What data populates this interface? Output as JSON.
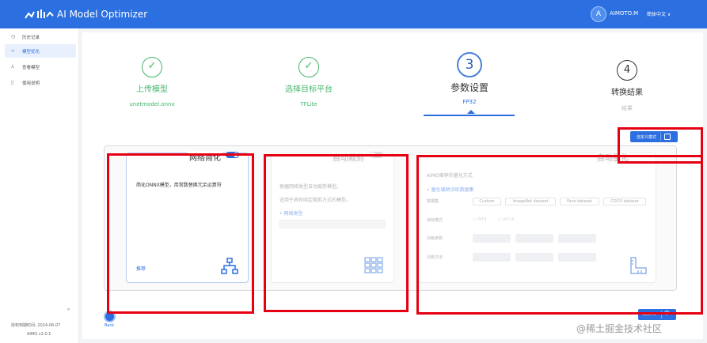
{
  "header": {
    "app_title": "AI Model Optimizer",
    "avatar_letter": "A",
    "username": "AIMOTO.M",
    "language": "簡体中文 ∨"
  },
  "sidebar": {
    "items": [
      {
        "icon": "history-icon",
        "glyph": "◷",
        "label": "历史记录"
      },
      {
        "icon": "code-icon",
        "glyph": "‹›",
        "label": "模型优化"
      },
      {
        "icon": "compare-icon",
        "glyph": "⅄",
        "label": "查看模型"
      },
      {
        "icon": "doc-icon",
        "glyph": "▯",
        "label": "使用说明"
      }
    ],
    "collapse_glyph": "≡",
    "license": "授权到期时间: 2024-06-07",
    "version": "AIMO v2.0.1"
  },
  "steps": [
    {
      "glyph": "✓",
      "title": "上传模型",
      "sub": "unetmodel.onnx",
      "state": "done"
    },
    {
      "glyph": "✓",
      "title": "选择目标平台",
      "sub": "TFLite",
      "state": "done"
    },
    {
      "glyph": "3",
      "title": "参数设置",
      "sub": "FP32",
      "state": "current"
    },
    {
      "glyph": "4",
      "title": "转换结果",
      "sub": "结果",
      "state": "pending"
    }
  ],
  "custom_mode_label": "自定义模式",
  "cards": {
    "network": {
      "title": "网络简化",
      "desc": "简化ONNX模型，用常数替换冗余运算符",
      "recommend": "推荐",
      "icon": "network-tree-icon",
      "enabled": true
    },
    "prune": {
      "title": "自动裁剪",
      "line1": "根据网络类型自动裁剪模型。",
      "line2": "适用于具有固定裁剪方式的模型。",
      "network_type": "• 网络类型",
      "icon": "grid-icon",
      "enabled": false
    },
    "quant": {
      "title": "自动量化",
      "desc": "AIMO推荐的量化方式",
      "calib_link": "• 量化辅助训练数据集",
      "dataset_label": "数据集",
      "datasets": [
        "Custom",
        "ImageNet dataset",
        "Face dataset",
        "COCO dataset"
      ],
      "target_label": "目标模式",
      "target_opts": [
        "○ INT8",
        "○ INT16"
      ],
      "train_label": "训练参数",
      "method_label": "训练方法",
      "icon": "ruler-icon",
      "enabled": false
    }
  },
  "submit_label": "Submit",
  "back_label": "Back",
  "watermark": "@稀土掘金技术社区",
  "colors": {
    "primary": "#2b6fe0",
    "success": "#46b56c",
    "highlight": "#e60012"
  }
}
